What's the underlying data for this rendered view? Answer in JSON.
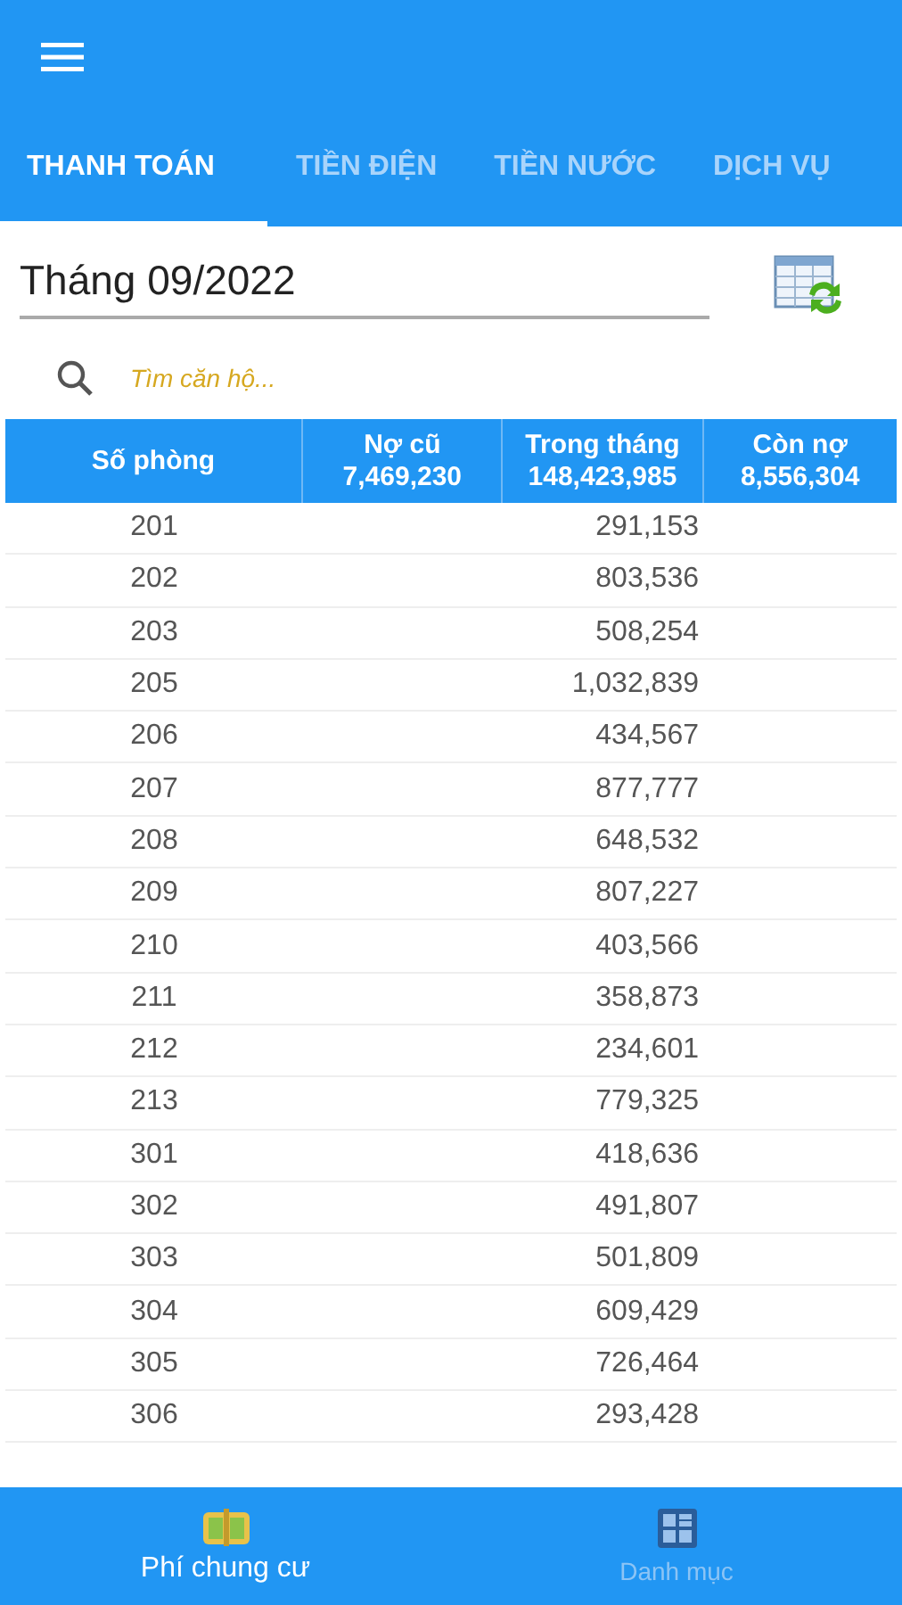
{
  "tabs": [
    {
      "label": "THANH TOÁN",
      "selected": true
    },
    {
      "label": "TIỀN ĐIỆN",
      "selected": false
    },
    {
      "label": "TIỀN NƯỚC",
      "selected": false
    },
    {
      "label": "DỊCH VỤ",
      "selected": false
    }
  ],
  "month": {
    "value": "Tháng 09/2022"
  },
  "search": {
    "placeholder": "Tìm căn hộ..."
  },
  "table": {
    "columns": [
      {
        "title": "Số phòng"
      },
      {
        "title": "Nợ cũ",
        "total": "7,469,230"
      },
      {
        "title": "Trong tháng",
        "total": "148,423,985"
      },
      {
        "title": "Còn nợ",
        "total": "8,556,304"
      }
    ],
    "rows": [
      {
        "room": "201",
        "month": "291,153"
      },
      {
        "room": "202",
        "month": "803,536"
      },
      {
        "room": "203",
        "month": "508,254"
      },
      {
        "room": "205",
        "month": "1,032,839"
      },
      {
        "room": "206",
        "month": "434,567"
      },
      {
        "room": "207",
        "month": "877,777"
      },
      {
        "room": "208",
        "month": "648,532"
      },
      {
        "room": "209",
        "month": "807,227"
      },
      {
        "room": "210",
        "month": "403,566"
      },
      {
        "room": "211",
        "month": "358,873"
      },
      {
        "room": "212",
        "month": "234,601"
      },
      {
        "room": "213",
        "month": "779,325"
      },
      {
        "room": "301",
        "month": "418,636"
      },
      {
        "room": "302",
        "month": "491,807"
      },
      {
        "room": "303",
        "month": "501,809"
      },
      {
        "room": "304",
        "month": "609,429"
      },
      {
        "room": "305",
        "month": "726,464"
      },
      {
        "room": "306",
        "month": "293,428"
      }
    ]
  },
  "bottom_nav": [
    {
      "label": "Phí chung cư",
      "selected": true,
      "kind": "wallet"
    },
    {
      "label": "Danh mục",
      "selected": false,
      "kind": "grid"
    }
  ]
}
